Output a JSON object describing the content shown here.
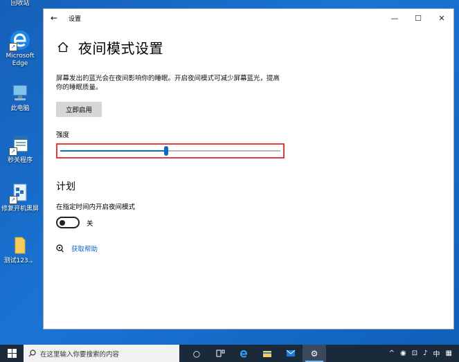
{
  "desktop": {
    "icons": [
      {
        "label": "回收站"
      },
      {
        "label": "Microsoft Edge"
      },
      {
        "label": "此电脑"
      },
      {
        "label": "秒关程序"
      },
      {
        "label": "修复开机黑屏"
      },
      {
        "label": "测试123.。"
      }
    ]
  },
  "window": {
    "title": "设置",
    "back_icon": "arrow-left-icon",
    "minimize": "—",
    "maximize": "☐",
    "close": "✕"
  },
  "page": {
    "title": "夜间模式设置",
    "description": "屏幕发出的蓝光会在夜间影响你的睡眠。开启夜间模式可减少屏幕蓝光，提高你的睡眠质量。",
    "enable_now_button": "立即启用",
    "strength_label": "强度",
    "strength_value": 0.48,
    "schedule_title": "计划",
    "schedule_label": "在指定时间内开启夜间模式",
    "schedule_toggle_text": "关",
    "help_link": "获取帮助"
  },
  "taskbar": {
    "search_placeholder": "在这里输入你要搜索的内容",
    "tray_ime": "中",
    "colors": {
      "accent": "#0a6bc6",
      "taskbar": "#1b2a3a"
    }
  }
}
